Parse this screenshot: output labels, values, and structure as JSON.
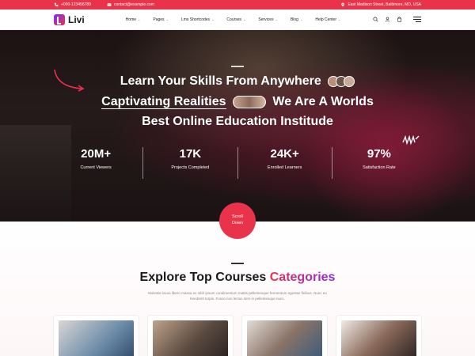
{
  "topbar": {
    "phone": "+000-123456789",
    "email": "contact@example.com",
    "address": "East Madison Street, Baltimore, MD, USA"
  },
  "brand": {
    "name": "Livi"
  },
  "nav": {
    "items": [
      {
        "label": "Home",
        "has_dropdown": true
      },
      {
        "label": "Pages",
        "has_dropdown": true
      },
      {
        "label": "Lms Shortcodes",
        "has_dropdown": true
      },
      {
        "label": "Courses",
        "has_dropdown": true
      },
      {
        "label": "Services",
        "has_dropdown": true
      },
      {
        "label": "Blog",
        "has_dropdown": true
      },
      {
        "label": "Help Center",
        "has_dropdown": true
      }
    ],
    "icons": [
      "search-icon",
      "user-icon",
      "cart-icon",
      "menu-icon"
    ]
  },
  "hero": {
    "line1": "Learn Your Skills From Anywhere",
    "line2_link": "Captivating Realities",
    "line2_rest": "We Are A Worlds",
    "line3": "Best Online Education Institude",
    "stats": [
      {
        "value": "20M+",
        "label": "Current Viewers"
      },
      {
        "value": "17K",
        "label": "Projects Completed"
      },
      {
        "value": "24K+",
        "label": "Enrolled Learners"
      },
      {
        "value": "97%",
        "label": "Satisfaction Rate"
      }
    ],
    "scroll_label_1": "Scroll",
    "scroll_label_2": "Down"
  },
  "courses": {
    "title_main": "Explore Top Courses ",
    "title_accent": "Categories",
    "description": "Molestie lacus libero massa ex nibh ipsum condimentum mattis pellentesque fermentum egestas finibus. Nunc eu hendrerit turpis. Fusce non lectus sem in pellentesque nunc."
  },
  "colors": {
    "accent": "#e8334a",
    "accent_purple": "#8a2be2",
    "dark": "#1a1a1a"
  }
}
